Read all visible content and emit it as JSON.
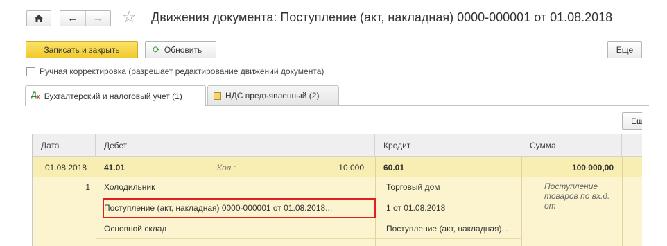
{
  "nav": {
    "home_icon": "home-icon",
    "back_arrow": "←",
    "forward_arrow": "→",
    "star": "☆"
  },
  "title": "Движения документа: Поступление (акт, накладная) 0000-000001 от 01.08.2018",
  "toolbar": {
    "save_close_label": "Записать и закрыть",
    "refresh_label": "Обновить",
    "more_label": "Еще"
  },
  "manual_edit": {
    "label": "Ручная корректировка (разрешает редактирование движений документа)",
    "checked": false
  },
  "tabs": [
    {
      "label": "Бухгалтерский и налоговый учет (1)",
      "icon": "accounting-icon",
      "active": true
    },
    {
      "label": "НДС предъявленный (2)",
      "icon": "register-icon",
      "active": false
    }
  ],
  "grid": {
    "more_label": "Ещ",
    "columns": [
      "Дата",
      "Дебет",
      "Кредит",
      "Сумма"
    ],
    "row": {
      "date": "01.08.2018",
      "debit_account": "41.01",
      "qty_label": "Кол.:",
      "qty_value": "10,000",
      "credit_account": "60.01",
      "amount": "100 000,00",
      "line_no": "1",
      "debit_subconto1": "Холодильник",
      "debit_subconto2": "Поступление (акт, накладная) 0000-000001 от 01.08.2018...",
      "debit_subconto3": "Основной склад",
      "credit_subconto1": "Торговый дом",
      "credit_subconto2": "1 от 01.08.2018",
      "credit_subconto3": "Поступление (акт, накладная)...",
      "content": "Поступление товаров по вх.д. от"
    }
  },
  "colors": {
    "accent_button": "#f1c92c",
    "row_highlight": "#f9eeb2",
    "row_sub": "#fbf4cf",
    "highlight_border": "#e02020"
  }
}
